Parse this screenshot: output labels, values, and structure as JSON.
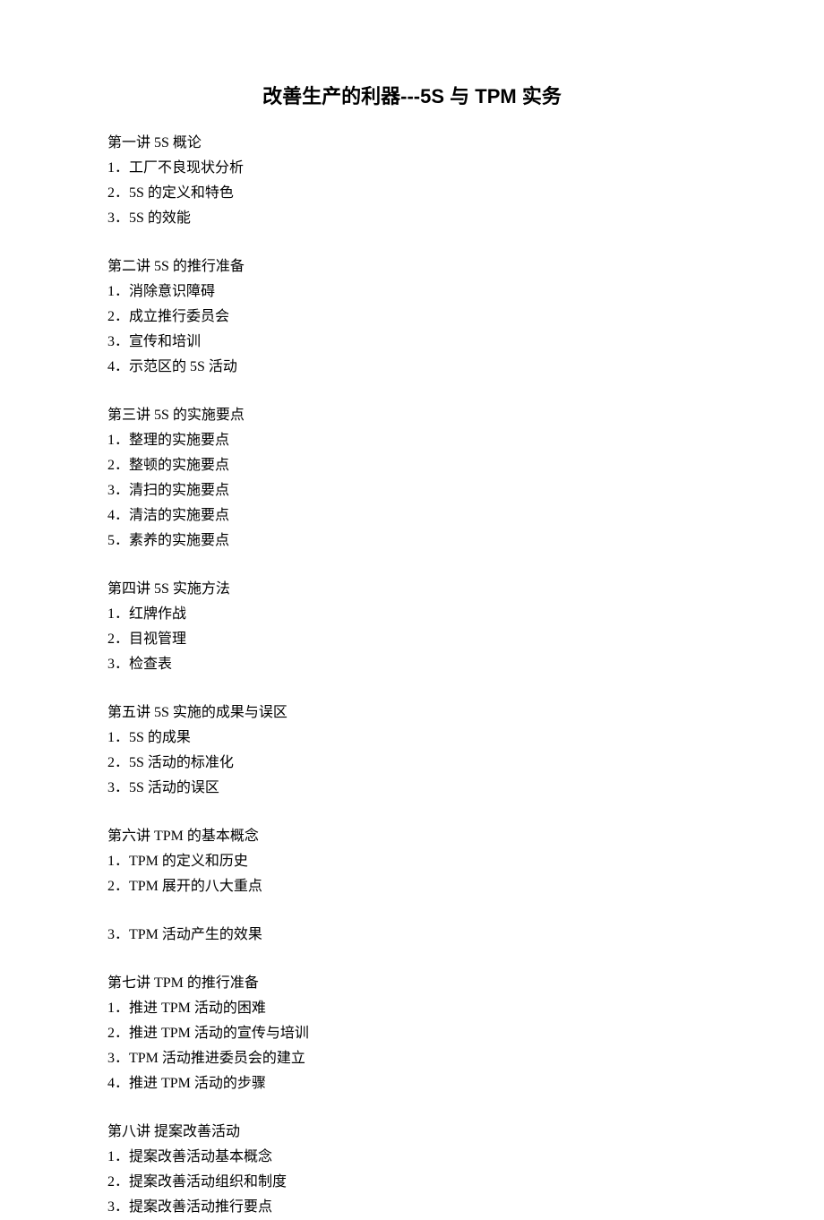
{
  "title": "改善生产的利器---5S 与 TPM 实务",
  "sections": [
    {
      "heading": "第一讲  5S 概论",
      "items": [
        "1．工厂不良现状分析",
        "2．5S 的定义和特色",
        "3．5S 的效能"
      ]
    },
    {
      "heading": "第二讲  5S 的推行准备",
      "items": [
        "1．消除意识障碍",
        "2．成立推行委员会",
        "3．宣传和培训",
        "4．示范区的 5S 活动"
      ]
    },
    {
      "heading": "第三讲  5S 的实施要点",
      "items": [
        "1．整理的实施要点",
        "2．整顿的实施要点",
        "3．清扫的实施要点",
        "4．清洁的实施要点",
        "5．素养的实施要点"
      ]
    },
    {
      "heading": "第四讲  5S 实施方法",
      "items": [
        "1．红牌作战",
        "2．目视管理",
        "3．检查表"
      ]
    },
    {
      "heading": "第五讲  5S 实施的成果与误区",
      "items": [
        "1．5S 的成果",
        "2．5S 活动的标准化",
        "3．5S 活动的误区"
      ]
    },
    {
      "heading": "第六讲  TPM 的基本概念",
      "items": [
        "1．TPM 的定义和历史",
        "2．TPM 展开的八大重点",
        "3．TPM 活动产生的效果"
      ],
      "gapBefore": 2
    },
    {
      "heading": "第七讲  TPM 的推行准备",
      "items": [
        "1．推进 TPM 活动的困难",
        "2．推进 TPM 活动的宣传与培训",
        "3．TPM 活动推进委员会的建立",
        "4．推进 TPM 活动的步骤"
      ]
    },
    {
      "heading": "第八讲  提案改善活动",
      "items": [
        "1．提案改善活动基本概念",
        "2．提案改善活动组织和制度",
        "3．提案改善活动推行要点"
      ]
    }
  ]
}
